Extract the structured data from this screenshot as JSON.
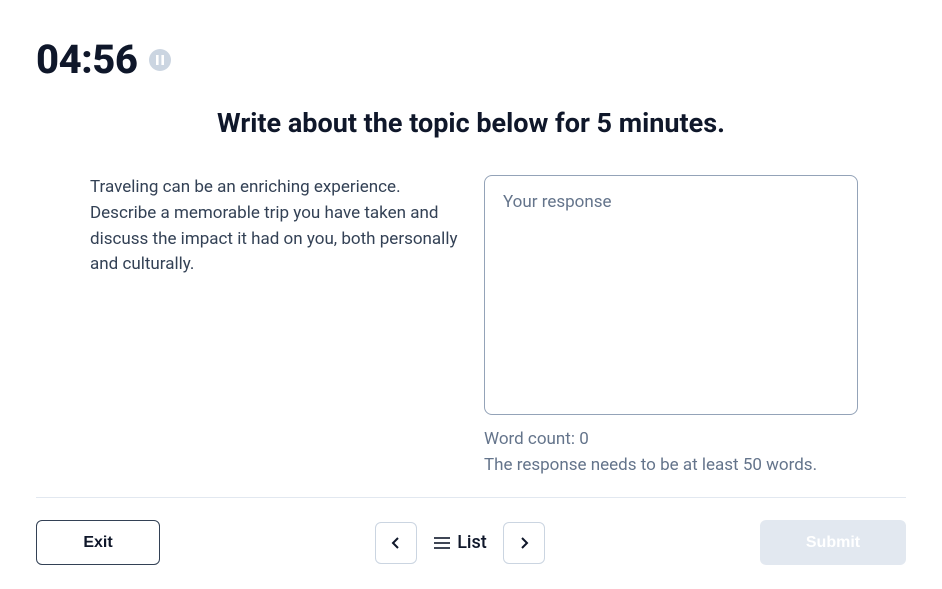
{
  "timer": "04:56",
  "title": "Write about the topic below for 5 minutes.",
  "prompt": "Traveling can be an enriching experience. Describe a memorable trip you have taken and discuss the impact it had on you, both personally and culturally.",
  "response": {
    "placeholder": "Your response",
    "value": ""
  },
  "word_count": {
    "label": "Word count: ",
    "value": "0"
  },
  "requirement": "The response needs to be at least 50 words.",
  "footer": {
    "exit_label": "Exit",
    "list_label": "List",
    "submit_label": "Submit"
  }
}
